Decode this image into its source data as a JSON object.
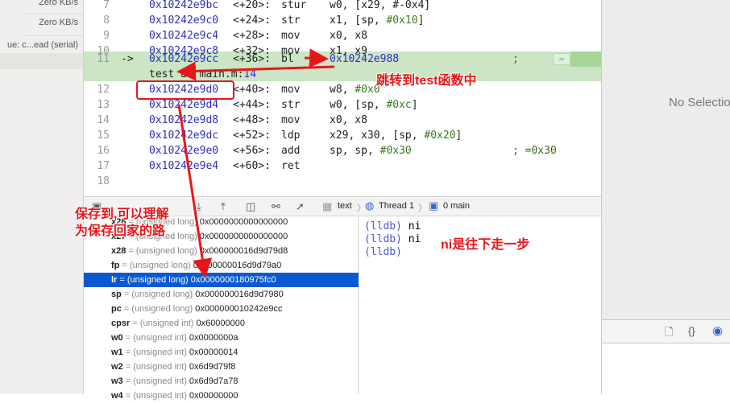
{
  "sidebar": {
    "rows": [
      "Zero KB/s",
      "Zero KB/s",
      "ue: c...ead (serial)"
    ]
  },
  "editor": {
    "lines": [
      {
        "n": "7",
        "addr": "0x10242e9bc",
        "off": "<+20>:",
        "mn": "stur",
        "ops": "w0, [x29, #-0x4]",
        "num": "",
        "cm": ""
      },
      {
        "n": "8",
        "addr": "0x10242e9c0",
        "off": "<+24>:",
        "mn": "str",
        "ops": "x1, [sp, ",
        "num": "#0x10",
        "tail": "]",
        "cm": ""
      },
      {
        "n": "9",
        "addr": "0x10242e9c4",
        "off": "<+28>:",
        "mn": "mov",
        "ops": "x0, x8",
        "num": "",
        "cm": ""
      },
      {
        "n": "10",
        "addr": "0x10242e9c8",
        "off": "<+32>:",
        "mn": "mov",
        "ops": "x1, x9",
        "num": "",
        "cm": ""
      },
      {
        "n": "11",
        "arrow": "->",
        "addr": "0x10242e9cc",
        "off": "<+36>:",
        "mn": "bl",
        "target": "0x10242e988",
        "cm": ";",
        "cont": "test at main.m:",
        "cont_num": "14"
      },
      {
        "n": "12",
        "addr": "0x10242e9d0",
        "off": "<+40>:",
        "mn": "mov",
        "ops": "w8, ",
        "num": "#0x0",
        "cm": ""
      },
      {
        "n": "13",
        "addr": "0x10242e9d4",
        "off": "<+44>:",
        "mn": "str",
        "ops": "w0, [sp, ",
        "num": "#0xc",
        "tail": "]",
        "cm": ""
      },
      {
        "n": "14",
        "addr": "0x10242e9d8",
        "off": "<+48>:",
        "mn": "mov",
        "ops": "x0, x8",
        "num": "",
        "cm": ""
      },
      {
        "n": "15",
        "addr": "0x10242e9dc",
        "off": "<+52>:",
        "mn": "ldp",
        "ops": "x29, x30, [sp, ",
        "num": "#0x20",
        "tail": "]",
        "cm": ""
      },
      {
        "n": "16",
        "addr": "0x10242e9e0",
        "off": "<+56>:",
        "mn": "add",
        "ops": "sp, sp, ",
        "num": "#0x30",
        "cm": "; =0x30"
      },
      {
        "n": "17",
        "addr": "0x10242e9e4",
        "off": "<+60>:",
        "mn": "ret",
        "ops": "",
        "num": "",
        "cm": ""
      },
      {
        "n": "18"
      }
    ],
    "badge": "="
  },
  "debugbar": {
    "crumb_text": "text",
    "crumb_thread": "Thread 1",
    "crumb_frame": "0 main"
  },
  "variables": [
    {
      "name": "x26",
      "type": "(unsigned long)",
      "value": "0x0000000000000000"
    },
    {
      "name": "x27",
      "type": "(unsigned long)",
      "value": "0x0000000000000000"
    },
    {
      "name": "x28",
      "type": "(unsigned long)",
      "value": "0x000000016d9d79d8"
    },
    {
      "name": "fp",
      "type": "(unsigned long)",
      "value": "0x000000016d9d79a0"
    },
    {
      "name": "lr",
      "type": "(unsigned long)",
      "value": "0x0000000180975fc0"
    },
    {
      "name": "sp",
      "type": "(unsigned long)",
      "value": "0x000000016d9d7980"
    },
    {
      "name": "pc",
      "type": "(unsigned long)",
      "value": "0x000000010242e9cc"
    },
    {
      "name": "cpsr",
      "type": "(unsigned int)",
      "value": "0x60000000"
    },
    {
      "name": "w0",
      "type": "(unsigned int)",
      "value": "0x0000000a"
    },
    {
      "name": "w1",
      "type": "(unsigned int)",
      "value": "0x00000014"
    },
    {
      "name": "w2",
      "type": "(unsigned int)",
      "value": "0x6d9d79f8"
    },
    {
      "name": "w3",
      "type": "(unsigned int)",
      "value": "0x6d9d7a78"
    },
    {
      "name": "w4",
      "type": "(unsigned int)",
      "value": "0x00000000"
    }
  ],
  "console": [
    {
      "prompt": "(lldb)",
      "cmd": " ni"
    },
    {
      "prompt": "(lldb)",
      "cmd": " ni"
    },
    {
      "prompt": "(lldb)",
      "cmd": ""
    }
  ],
  "inspector": {
    "no_selection": "No Selection"
  },
  "annotations": {
    "jump": "跳转到test函数中",
    "save_line1": "保存到,可以理解",
    "save_line2": "为保存回家的路",
    "ni": "ni是往下走一步"
  },
  "colors": {
    "highlight_line": "#cbe5c5",
    "selection": "#0a59d0",
    "annotation": "#e8161b",
    "address": "#2e2ec0"
  }
}
